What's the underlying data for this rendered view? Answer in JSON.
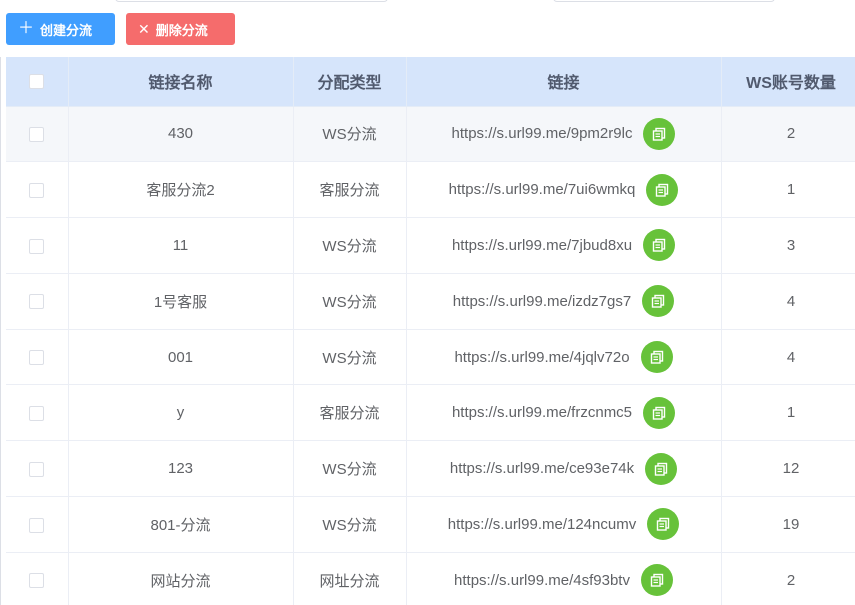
{
  "toolbar": {
    "create_label": "创建分流",
    "delete_label": "删除分流",
    "create_icon": "plus-icon",
    "delete_icon": "close-icon"
  },
  "colors": {
    "primary": "#409eff",
    "danger": "#f56c6c",
    "copy": "#67c23a",
    "header_bg": "#d6e5fb"
  },
  "table": {
    "headers": {
      "name": "链接名称",
      "type": "分配类型",
      "link": "链接",
      "count": "WS账号数量"
    },
    "rows": [
      {
        "name": "430",
        "type": "WS分流",
        "link": "https://s.url99.me/9pm2r9lc",
        "count": "2"
      },
      {
        "name": "客服分流2",
        "type": "客服分流",
        "link": "https://s.url99.me/7ui6wmkq",
        "count": "1"
      },
      {
        "name": "11",
        "type": "WS分流",
        "link": "https://s.url99.me/7jbud8xu",
        "count": "3"
      },
      {
        "name": "1号客服",
        "type": "WS分流",
        "link": "https://s.url99.me/izdz7gs7",
        "count": "4"
      },
      {
        "name": "001",
        "type": "WS分流",
        "link": "https://s.url99.me/4jqlv72o",
        "count": "4"
      },
      {
        "name": "y",
        "type": "客服分流",
        "link": "https://s.url99.me/frzcnmc5",
        "count": "1"
      },
      {
        "name": "123",
        "type": "WS分流",
        "link": "https://s.url99.me/ce93e74k",
        "count": "12"
      },
      {
        "name": "801-分流",
        "type": "WS分流",
        "link": "https://s.url99.me/124ncumv",
        "count": "19"
      },
      {
        "name": "网站分流",
        "type": "网址分流",
        "link": "https://s.url99.me/4sf93btv",
        "count": "2"
      }
    ]
  }
}
